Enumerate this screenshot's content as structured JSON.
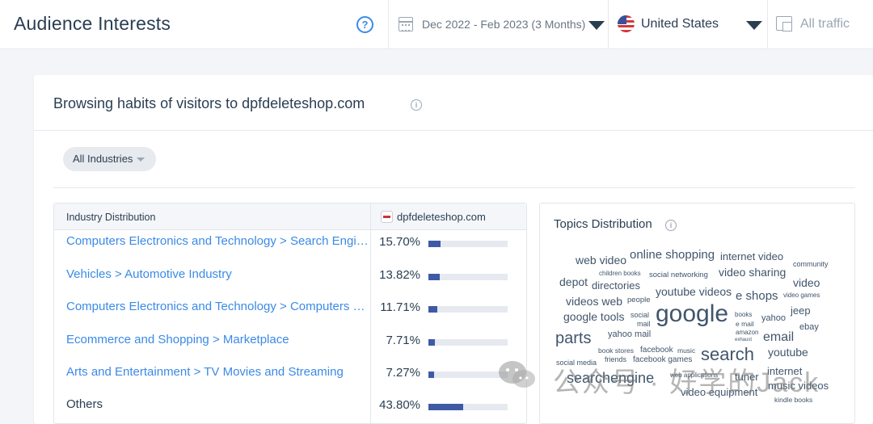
{
  "header": {
    "title": "Audience Interests",
    "date_range": "Dec 2022 - Feb 2023 (3 Months)",
    "country": "United States",
    "traffic": "All traffic"
  },
  "card": {
    "title": "Browsing habits of visitors to dpfdeleteshop.com",
    "filter_label": "All Industries"
  },
  "industry_table": {
    "column_header": "Industry Distribution",
    "site_header": "dpfdeleteshop.com",
    "rows": [
      {
        "label": "Computers Electronics and Technology > Search Engines",
        "pct": "15.70%",
        "value": 15.7,
        "link": true
      },
      {
        "label": "Vehicles > Automotive Industry",
        "pct": "13.82%",
        "value": 13.82,
        "link": true
      },
      {
        "label": "Computers Electronics and Technology > Computers Electronics and Technology",
        "pct": "11.71%",
        "value": 11.71,
        "link": true
      },
      {
        "label": "Ecommerce and Shopping > Marketplace",
        "pct": "7.71%",
        "value": 7.71,
        "link": true
      },
      {
        "label": "Arts and Entertainment > TV Movies and Streaming",
        "pct": "7.27%",
        "value": 7.27,
        "link": true
      },
      {
        "label": "Others",
        "pct": "43.80%",
        "value": 43.8,
        "link": false
      }
    ]
  },
  "topics": {
    "title": "Topics Distribution",
    "words": [
      "web video",
      "online shopping",
      "internet video",
      "community",
      "children books",
      "social networking",
      "video sharing",
      "depot",
      "directories",
      "video",
      "youtube videos",
      "e shops",
      "video games",
      "videos web",
      "people",
      "google tools",
      "social",
      "mail",
      "google",
      "books",
      "yahoo",
      "jeep",
      "e mail",
      "ebay",
      "amazon",
      "exhaust",
      "parts",
      "yahoo mail",
      "email",
      "book stores",
      "facebook",
      "music",
      "youtube",
      "friends",
      "facebook games",
      "search",
      "social media",
      "internet",
      "searchengine",
      "web applications",
      "tuner",
      "music videos",
      "video equipment",
      "kindle books"
    ]
  },
  "watermark": {
    "text": "公众号 · 好学的Jack"
  }
}
